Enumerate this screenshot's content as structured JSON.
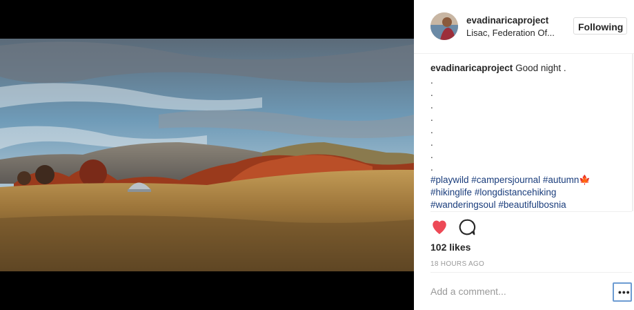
{
  "post": {
    "username": "evadinaricaproject",
    "location": "Lisac, Federation Of...",
    "follow_label": "Following",
    "caption": {
      "username": "evadinaricaproject",
      "text": " Good night .",
      "dots": [
        ".",
        ".",
        ".",
        ".",
        ".",
        ".",
        ".",
        "."
      ],
      "hashtag_lines": [
        [
          "#playwild",
          "#campersjournal",
          "#autumn🍁"
        ],
        [
          "#hikinglife",
          "#longdistancehiking"
        ],
        [
          "#wanderingsoul",
          "#beautifulbosnia"
        ]
      ]
    },
    "likes": "102 likes",
    "timestamp": "18 HOURS AGO",
    "comment_placeholder": "Add a comment...",
    "more_label": "•••"
  },
  "icons": {
    "like": "heart-icon",
    "comment": "speech-bubble-icon"
  },
  "colors": {
    "heart": "#ed4956",
    "hashtag": "#1a3d7c",
    "focus_border": "#6c9bd2"
  }
}
